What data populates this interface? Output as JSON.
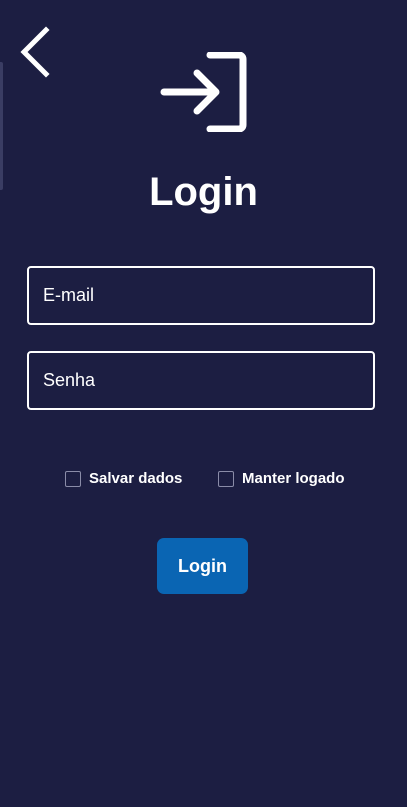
{
  "header": {
    "back_icon": "chevron-left-icon",
    "login_icon": "login-arrow-icon",
    "title": "Login"
  },
  "form": {
    "email": {
      "placeholder": "E-mail",
      "value": ""
    },
    "password": {
      "placeholder": "Senha",
      "value": ""
    },
    "options": {
      "save_data_label": "Salvar dados",
      "save_data_checked": false,
      "keep_logged_label": "Manter logado",
      "keep_logged_checked": false
    },
    "submit_label": "Login"
  },
  "colors": {
    "background": "#1c1e42",
    "primary_button": "#0a65b3",
    "text": "#ffffff"
  }
}
